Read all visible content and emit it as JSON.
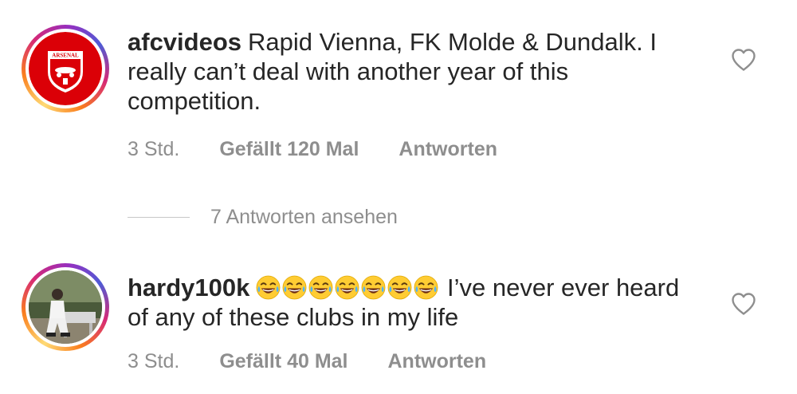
{
  "comments": [
    {
      "username": "afcvideos",
      "text": "Rapid Vienna, FK Molde & Dundalk. I really can’t deal with another year of this competition.",
      "time": "3 Std.",
      "likes": "Gefällt 120 Mal",
      "reply": "Antworten",
      "avatar_badge": "ARSENAL"
    },
    {
      "username": "hardy100k",
      "emoji_count": 7,
      "emoji_icon": "tears-of-joy-emoji",
      "text": "I’ve never ever heard of any of these clubs in my life",
      "time": "3 Std.",
      "likes": "Gefällt 40 Mal",
      "reply": "Antworten"
    }
  ],
  "view_replies": "7 Antworten ansehen",
  "colors": {
    "text": "#262626",
    "secondary": "#8e8e8e",
    "arsenal_red": "#db0007"
  }
}
